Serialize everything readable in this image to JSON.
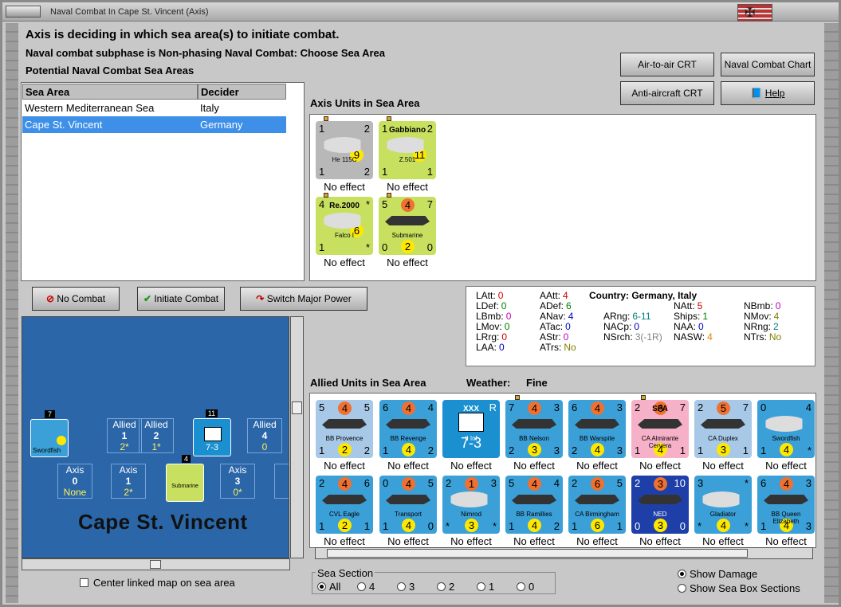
{
  "window": {
    "title": "Naval Combat In Cape St. Vincent (Axis)"
  },
  "header": {
    "line1": "Axis is deciding in which sea area(s) to initiate combat.",
    "line2": "Naval combat subphase is Non-phasing Naval Combat: Choose Sea Area",
    "line3": "Potential Naval Combat Sea Areas"
  },
  "buttons": {
    "air_crt": "Air-to-air CRT",
    "naval_chart": "Naval Combat Chart",
    "aa_crt": "Anti-aircraft CRT",
    "help": "Help",
    "no_combat": "No Combat",
    "initiate": "Initiate Combat",
    "switch": "Switch Major Power"
  },
  "sea_table": {
    "headers": [
      "Sea Area",
      "Decider"
    ],
    "rows": [
      {
        "area": "Western Mediterranean Sea",
        "decider": "Italy"
      },
      {
        "area": "Cape St. Vincent",
        "decider": "Germany"
      }
    ]
  },
  "axis_units_label": "Axis Units in Sea Area",
  "allied_units_label": "Allied Units in Sea Area",
  "weather": {
    "label": "Weather:",
    "value": "Fine"
  },
  "effect_text": "No effect",
  "axis_units": [
    {
      "name": "He 115C",
      "tl": "1",
      "tr": "2",
      "bl": "1",
      "br": "2",
      "mid": "9",
      "bg": "#b8b8b8"
    },
    {
      "name": "Z.501",
      "top": "Gabbiano",
      "tl": "1",
      "tr": "2",
      "bl": "1",
      "br": "1",
      "mid": "11",
      "bg": "#c8e060"
    },
    {
      "name": "Falco I",
      "top": "Re.2000",
      "tl": "4",
      "tr": "*",
      "bl": "1",
      "br": "*",
      "mid": "6",
      "bg": "#c8e060"
    },
    {
      "name": "Submarine",
      "tl": "5",
      "tm": "4",
      "tr": "7",
      "bl": "0",
      "bm": "2",
      "br": "0",
      "bg": "#c8e060"
    }
  ],
  "stats": {
    "country": "Country: Germany, Italy",
    "items": [
      {
        "k": "LAtt:",
        "v": "0",
        "c": "#d00000"
      },
      {
        "k": "LDef:",
        "v": "0",
        "c": "#008000"
      },
      {
        "k": "LBmb:",
        "v": "0",
        "c": "#c000c0"
      },
      {
        "k": "LMov:",
        "v": "0",
        "c": "#008000"
      },
      {
        "k": "LRrg:",
        "v": "0",
        "c": "#d00000"
      },
      {
        "k": "LAA:",
        "v": "0",
        "c": "#0000c0"
      },
      {
        "k": "AAtt:",
        "v": "4",
        "c": "#d00000"
      },
      {
        "k": "ADef:",
        "v": "6",
        "c": "#008000"
      },
      {
        "k": "ANav:",
        "v": "4",
        "c": "#0000c0"
      },
      {
        "k": "ATac:",
        "v": "0",
        "c": "#0000c0"
      },
      {
        "k": "AStr:",
        "v": "0",
        "c": "#c000c0"
      },
      {
        "k": "ATrs:",
        "v": "No",
        "c": "#808000"
      },
      {
        "k": "ARng:",
        "v": "6-11",
        "c": "#008080"
      },
      {
        "k": "NACp:",
        "v": "0",
        "c": "#0000c0"
      },
      {
        "k": "NSrch:",
        "v": "3(-1R)",
        "c": "#808080"
      },
      {
        "k": "NAtt:",
        "v": "5",
        "c": "#d00000"
      },
      {
        "k": "Ships:",
        "v": "1",
        "c": "#008000"
      },
      {
        "k": "NAA:",
        "v": "0",
        "c": "#0000c0"
      },
      {
        "k": "NASW:",
        "v": "4",
        "c": "#e08000"
      },
      {
        "k": "NBmb:",
        "v": "0",
        "c": "#c000c0"
      },
      {
        "k": "NMov:",
        "v": "4",
        "c": "#808000"
      },
      {
        "k": "NRng:",
        "v": "2",
        "c": "#008080"
      },
      {
        "k": "NTrs:",
        "v": "No",
        "c": "#808000"
      }
    ]
  },
  "allied_row1": [
    {
      "name": "BB Provence",
      "tl": "5",
      "tm": "4",
      "tr": "5",
      "bl": "1",
      "bm": "2",
      "br": "2",
      "bg": "#a8c8e8"
    },
    {
      "name": "BB Revenge",
      "tl": "6",
      "tm": "4",
      "tr": "4",
      "bl": "1",
      "bm": "4",
      "br": "2",
      "bg": "#3ba0d8"
    },
    {
      "name": "II Inf",
      "top": "XXX",
      "tr": "R",
      "big": "7-3",
      "bg": "#1a90d0"
    },
    {
      "name": "BB Nelson",
      "tl": "7",
      "tm": "4",
      "tr": "3",
      "bl": "2",
      "bm": "3",
      "br": "3",
      "bg": "#3ba0d8"
    },
    {
      "name": "BB Warspite",
      "tl": "6",
      "tm": "4",
      "tr": "3",
      "bl": "2",
      "bm": "4",
      "br": "3",
      "bg": "#3ba0d8"
    },
    {
      "name": "CA Almirante Cervera",
      "top": "SPA",
      "tl": "2",
      "tm": "6",
      "tr": "7",
      "bl": "1",
      "bm": "4",
      "br": "1",
      "bg": "#f6b0c8"
    },
    {
      "name": "CA Duplex",
      "tl": "2",
      "tm": "5",
      "tr": "7",
      "bl": "1",
      "bm": "3",
      "br": "1",
      "bg": "#a8c8e8"
    },
    {
      "name": "Swordfish",
      "tl": "0",
      "tr": "4",
      "bl": "1",
      "bm": "4",
      "br": "*",
      "bg": "#3ba0d8"
    }
  ],
  "allied_row2": [
    {
      "name": "CVL Eagle",
      "tl": "2",
      "tm": "4",
      "tr": "6",
      "bl": "1",
      "bm": "2",
      "br": "1",
      "bg": "#3ba0d8"
    },
    {
      "name": "Transport",
      "tl": "0",
      "tm": "4",
      "tr": "5",
      "bl": "1",
      "bm": "4",
      "br": "0",
      "bg": "#3ba0d8"
    },
    {
      "name": "Nimrod",
      "tl": "2",
      "tm": "1",
      "tr": "3",
      "bl": "*",
      "bm": "3",
      "br": "*",
      "bg": "#3ba0d8"
    },
    {
      "name": "BB Ramillies",
      "tl": "5",
      "tm": "4",
      "tr": "4",
      "bl": "1",
      "bm": "4",
      "br": "2",
      "bg": "#3ba0d8"
    },
    {
      "name": "CA Birmingham",
      "tl": "2",
      "tm": "6",
      "tr": "5",
      "bl": "1",
      "bm": "6",
      "br": "1",
      "bg": "#3ba0d8"
    },
    {
      "name": "NED",
      "tl": "2",
      "tm": "3",
      "tr": "10",
      "bl": "0",
      "bm": "3",
      "br": "0",
      "bg": "#1e3fa8"
    },
    {
      "name": "Gladiator",
      "tl": "3",
      "tr": "*",
      "bl": "*",
      "bm": "4",
      "br": "*",
      "bg": "#3ba0d8"
    },
    {
      "name": "BB Queen Elizabeth",
      "tl": "6",
      "tm": "4",
      "tr": "3",
      "bl": "1",
      "bm": "4",
      "br": "3",
      "bg": "#3ba0d8"
    }
  ],
  "map": {
    "name": "Cape St. Vincent",
    "allied_boxes": [
      {
        "label": "Allied",
        "n": "1",
        "v": "2*"
      },
      {
        "label": "Allied",
        "n": "2",
        "v": "1*"
      },
      {
        "label": "Allied",
        "n": "4",
        "v": "0"
      }
    ],
    "axis_boxes": [
      {
        "label": "Axis",
        "n": "0",
        "v": "None"
      },
      {
        "label": "Axis",
        "n": "1",
        "v": "2*"
      },
      {
        "label": "Axis",
        "n": "3",
        "v": "0*"
      },
      {
        "label": "A"
      }
    ],
    "stack_counts": [
      "7",
      "11",
      "4"
    ],
    "unit_labels": {
      "swordfish": "Swordfish",
      "submarine": "Submarine",
      "inf": "7-3"
    }
  },
  "center_map": "Center linked map on sea area",
  "sea_section": {
    "label": "Sea Section",
    "options": [
      "All",
      "4",
      "3",
      "2",
      "1",
      "0"
    ],
    "selected": "All"
  },
  "show_damage": "Show Damage",
  "show_sea_box": "Show Sea Box Sections"
}
